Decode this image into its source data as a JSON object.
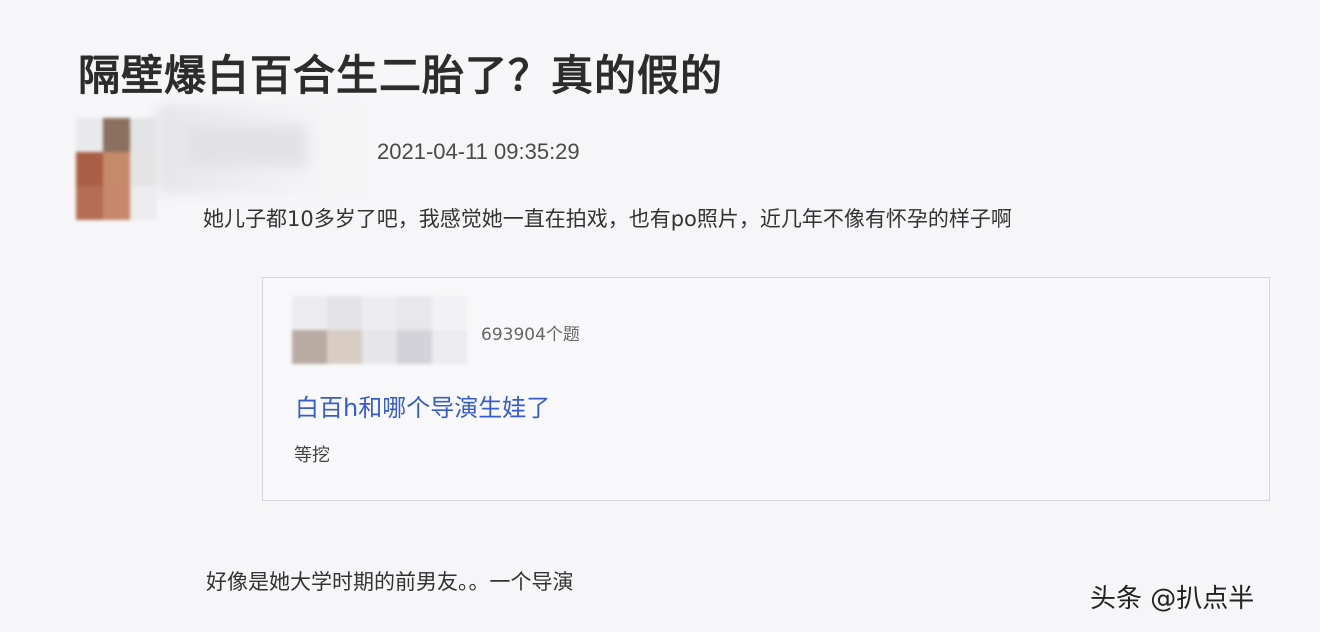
{
  "post": {
    "title": "隔壁爆白百合生二胎了？真的假的",
    "timestamp": "2021-04-11 09:35:29",
    "body": "她儿子都10多岁了吧，我感觉她一直在拍戏，也有po照片，近几年不像有怀孕的样子啊"
  },
  "quote": {
    "user_id": "693904个题",
    "title": "白百h和哪个导演生娃了",
    "body": "等挖"
  },
  "reply": {
    "text": "好像是她大学时期的前男友。。一个导演"
  },
  "watermark": {
    "text": "头条 @扒点半"
  },
  "colors": {
    "background": "#f6f6f8",
    "quote_title": "#3a5cc6",
    "quote_border": "#d6d6dc"
  }
}
